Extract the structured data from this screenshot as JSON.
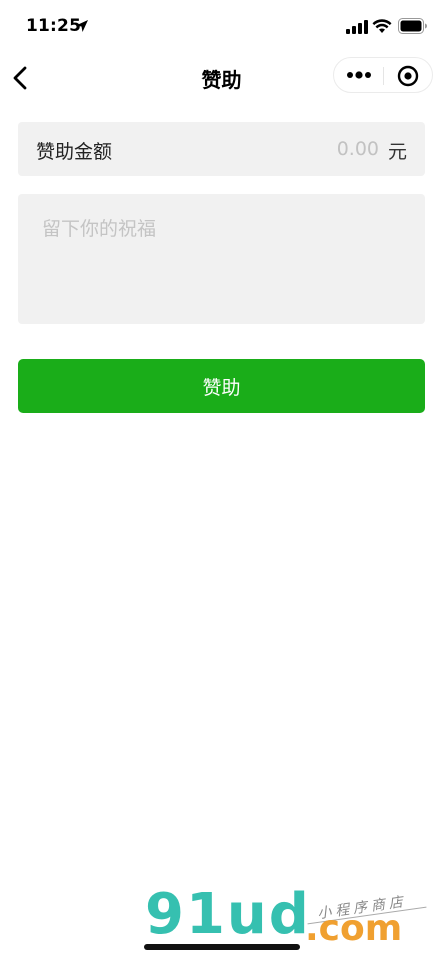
{
  "status_bar": {
    "time": "11:25",
    "icons": [
      "location-arrow-icon",
      "signal-icon",
      "wifi-icon",
      "battery-icon"
    ]
  },
  "nav": {
    "title": "赞助",
    "back_icon": "chevron-left-icon",
    "capsule_icons": [
      "more-dots-icon",
      "close-miniprogram-icon"
    ]
  },
  "form": {
    "amount_label": "赞助金额",
    "amount_placeholder": "0.00",
    "amount_unit": "元",
    "message_placeholder": "留下你的祝福",
    "submit_label": "赞助"
  },
  "watermark": {
    "brand": "91ud",
    "suffix": ".com",
    "tagline": "小程序商店"
  },
  "colors": {
    "primary_green": "#1aad19",
    "field_bg": "#f1f1f1",
    "placeholder": "#c2c2c2",
    "watermark_teal": "#36c0b0",
    "watermark_orange": "#f0a030"
  }
}
